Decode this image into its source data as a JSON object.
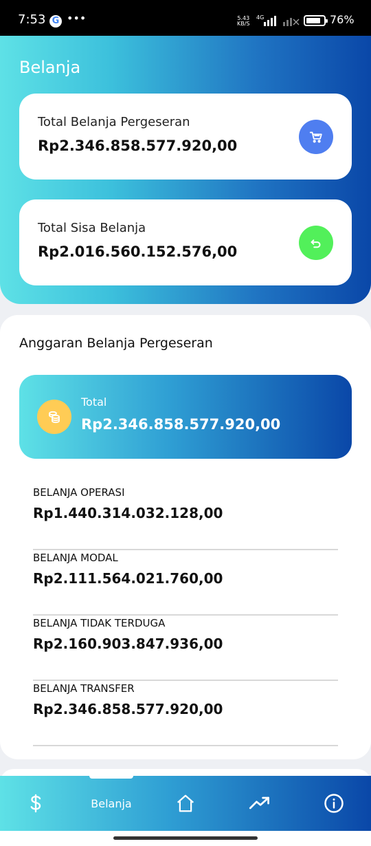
{
  "status_bar": {
    "time": "7:53",
    "speed_top": "5.43",
    "speed_bottom": "KB/S",
    "network": "4G",
    "battery": "76%"
  },
  "header": {
    "title": "Belanja"
  },
  "summary": {
    "total_belanja": {
      "label": "Total Belanja Pergeseran",
      "value": "Rp2.346.858.577.920,00",
      "icon": "cart-icon",
      "icon_color": "#4f7ef0"
    },
    "total_sisa": {
      "label": "Total Sisa Belanja",
      "value": "Rp2.016.560.152.576,00",
      "icon": "undo-icon",
      "icon_color": "#52f05a"
    }
  },
  "budget": {
    "title": "Anggaran Belanja Pergeseran",
    "total": {
      "label": "Total",
      "value": "Rp2.346.858.577.920,00",
      "icon": "coins-icon",
      "icon_color": "#ffcc55"
    },
    "items": [
      {
        "label": "BELANJA OPERASI",
        "value": "Rp1.440.314.032.128,00"
      },
      {
        "label": "BELANJA MODAL",
        "value": "Rp2.111.564.021.760,00"
      },
      {
        "label": "BELANJA TIDAK TERDUGA",
        "value": "Rp2.160.903.847.936,00"
      },
      {
        "label": "BELANJA TRANSFER",
        "value": "Rp2.346.858.577.920,00"
      }
    ]
  },
  "bottom_nav": {
    "items": [
      {
        "icon": "dollar-icon"
      },
      {
        "label": "Belanja",
        "active": true
      },
      {
        "icon": "home-icon"
      },
      {
        "icon": "trending-up-icon"
      },
      {
        "icon": "info-icon"
      }
    ]
  },
  "colors": {
    "gradient_start": "#5ee1e6",
    "gradient_end": "#0a47a8"
  }
}
